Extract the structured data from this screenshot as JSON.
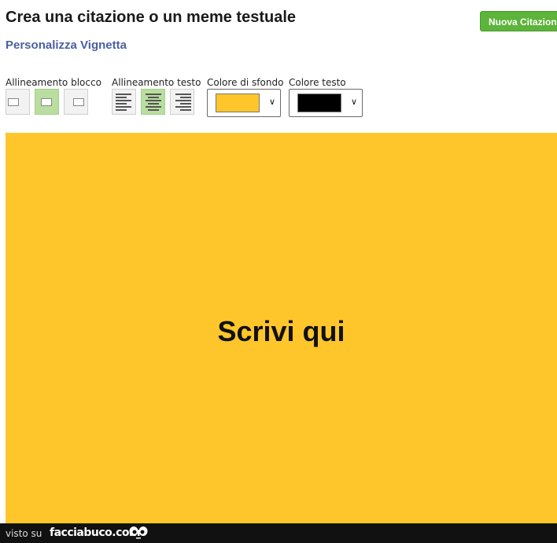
{
  "header": {
    "title": "Crea una citazione o un meme testuale",
    "subtitle": "Personalizza Vignetta",
    "new_button_label": "Nuova Citazione"
  },
  "toolbar": {
    "block_align_label": "Allineamento blocco",
    "text_align_label": "Allineamento testo",
    "bg_color_label": "Colore di sfondo",
    "text_color_label": "Colore testo",
    "block_align_options": [
      "left",
      "center",
      "right"
    ],
    "block_align_selected": "center",
    "text_align_options": [
      "left",
      "center",
      "right"
    ],
    "text_align_selected": "center",
    "bg_color": "#fec62b",
    "text_color": "#000000"
  },
  "canvas": {
    "text": "Scrivi qui",
    "background": "#fec62b",
    "text_color": "#111111"
  },
  "footer": {
    "prefix": "visto su",
    "brand": "facciabuco.com",
    "logo_icon": "eyes-icon"
  }
}
